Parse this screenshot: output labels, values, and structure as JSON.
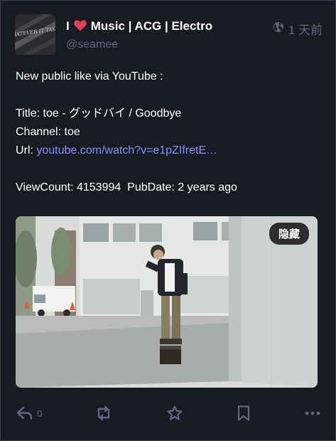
{
  "status": {
    "display_name_prefix": "I",
    "display_name_suffix": "Music | ACG | Electro",
    "handle": "@seamee",
    "timestamp": "1 天前",
    "visibility_icon": "globe-icon",
    "avatar_text": "WHATEVER IT TAKES",
    "content": {
      "line1": "New public like via YouTube :",
      "title_label": "Title: ",
      "title_value": "toe - グッドバイ / Goodbye",
      "channel_label": "Channel: ",
      "channel_value": "toe",
      "url_label": "Url: ",
      "url_value": "youtube.com/watch?v=e1pZIfretE…",
      "view_label": "ViewCount: ",
      "view_value": "4153994",
      "pub_label": "PubDate: ",
      "pub_value": "2 years ago"
    },
    "media": {
      "hide_label": "隐藏"
    },
    "actions": {
      "reply_count": "0",
      "reply_icon": "reply-icon",
      "boost_icon": "boost-icon",
      "favourite_icon": "star-icon",
      "bookmark_icon": "bookmark-icon",
      "more_icon": "more-icon"
    },
    "colors": {
      "background": "#191b22",
      "muted": "#606984",
      "link": "#8c8dff",
      "heart": "#df405a"
    }
  }
}
